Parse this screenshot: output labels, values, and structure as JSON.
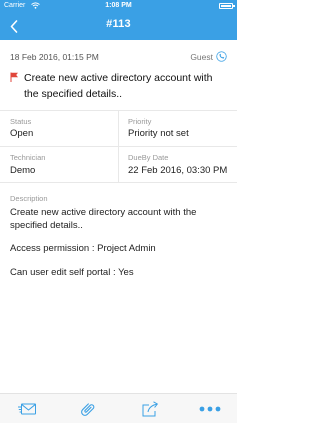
{
  "status_bar": {
    "carrier": "Carrier",
    "time": "1:08 PM"
  },
  "nav": {
    "title": "#113",
    "back_icon": "chevron-left-icon"
  },
  "request": {
    "created": "18 Feb 2016, 01:15 PM",
    "requester": "Guest",
    "subject": "Create new active directory account with the specified details.."
  },
  "fields": {
    "status_label": "Status",
    "status_value": "Open",
    "priority_label": "Priority",
    "priority_value": "Priority not set",
    "technician_label": "Technician",
    "technician_value": "Demo",
    "dueby_label": "DueBy Date",
    "dueby_value": "22 Feb 2016, 03:30 PM"
  },
  "description": {
    "label": "Description",
    "paragraphs": [
      "Create new active directory account with the specified details..",
      "Access permission : Project Admin",
      "Can user edit self portal : Yes"
    ]
  },
  "toolbar": {
    "icons": [
      "mail-icon",
      "attachment-icon",
      "share-icon",
      "more-icon"
    ]
  },
  "colors": {
    "header": "#3aa0e5",
    "accent": "#3aa0e5",
    "flag": "#e0463b"
  }
}
